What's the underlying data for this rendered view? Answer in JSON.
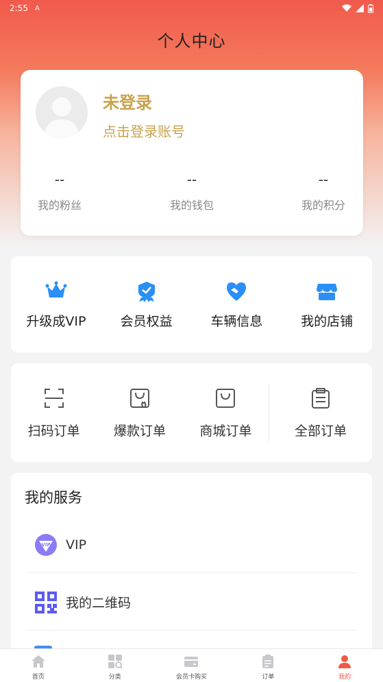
{
  "status": {
    "time": "2:55",
    "sim": "A"
  },
  "page": {
    "title": "个人中心"
  },
  "profile": {
    "login_title": "未登录",
    "login_sub": "点击登录账号",
    "stats": [
      {
        "value": "--",
        "label": "我的粉丝"
      },
      {
        "value": "--",
        "label": "我的钱包"
      },
      {
        "value": "--",
        "label": "我的积分"
      }
    ]
  },
  "quick": [
    {
      "label": "升级成VIP",
      "icon": "crown-icon"
    },
    {
      "label": "会员权益",
      "icon": "medal-icon"
    },
    {
      "label": "车辆信息",
      "icon": "handshake-icon"
    },
    {
      "label": "我的店铺",
      "icon": "store-icon"
    }
  ],
  "orders": [
    {
      "label": "扫码订单",
      "icon": "scan-icon"
    },
    {
      "label": "爆款订单",
      "icon": "hot-bag-icon"
    },
    {
      "label": "商城订单",
      "icon": "bag-icon"
    },
    {
      "label": "全部订单",
      "icon": "clipboard-icon"
    }
  ],
  "services": {
    "title": "我的服务",
    "items": [
      {
        "label": "VIP",
        "icon": "vip-icon"
      },
      {
        "label": "我的二维码",
        "icon": "qrcode-icon"
      }
    ]
  },
  "tabs": [
    {
      "label": "首页",
      "icon": "home-icon"
    },
    {
      "label": "分类",
      "icon": "category-icon"
    },
    {
      "label": "会员卡购买",
      "icon": "card-icon"
    },
    {
      "label": "订单",
      "icon": "order-icon"
    },
    {
      "label": "我的",
      "icon": "user-icon",
      "active": true
    }
  ],
  "colors": {
    "accent": "#f05a44",
    "gold": "#c8a24e",
    "blue": "#2a8ff7"
  }
}
